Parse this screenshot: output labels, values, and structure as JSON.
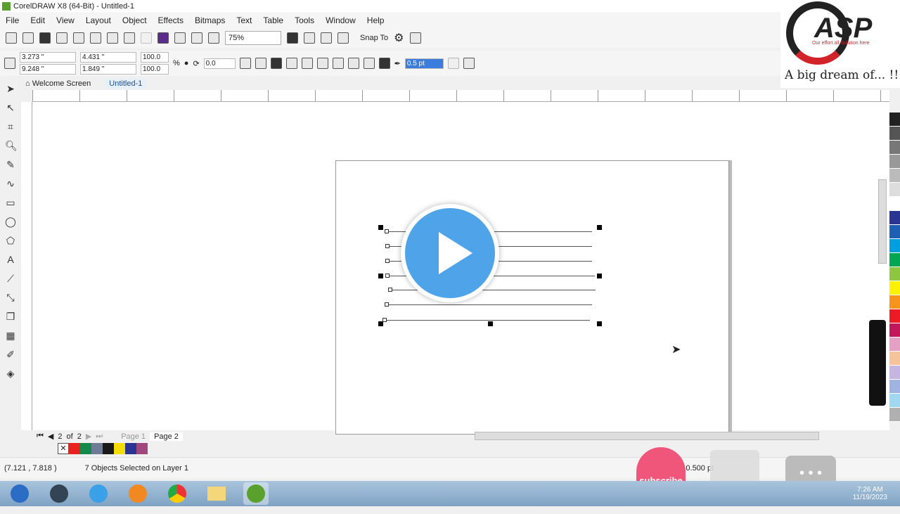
{
  "title": "CorelDRAW X8 (64-Bit) - Untitled-1",
  "menu": [
    "File",
    "Edit",
    "View",
    "Layout",
    "Object",
    "Effects",
    "Bitmaps",
    "Text",
    "Table",
    "Tools",
    "Window",
    "Help"
  ],
  "toolbar": {
    "zoom": "75%",
    "snap": "Snap To"
  },
  "props": {
    "x": "3.273 \"",
    "y": "9.248 \"",
    "w": "4.431 \"",
    "h": "1.849 \"",
    "sx": "100.0",
    "sy": "100.0",
    "pct": "%",
    "rot": "0.0",
    "outline": "0.5 pt"
  },
  "tabs": [
    "Welcome Screen",
    "Untitled-1"
  ],
  "pagenav": {
    "counter": "2",
    "of": "of",
    "total": "2",
    "pages": [
      "Page 1",
      "Page 2"
    ]
  },
  "doc_palette": [
    "#e8231f",
    "#13894a",
    "#6f7c95",
    "#1a1a1a",
    "#f7dc00",
    "#2a3593",
    "#a0487e"
  ],
  "palette": [
    "#222222",
    "#555555",
    "#777777",
    "#999999",
    "#bbbbbb",
    "#dddddd",
    "#ffffff",
    "#2a3593",
    "#1e5fb4",
    "#00a0e0",
    "#00a651",
    "#8dc63f",
    "#fff200",
    "#f7941d",
    "#ed1c24",
    "#c2185b",
    "#e6a0c4",
    "#f5c49a",
    "#c5b5e0",
    "#9fb4e0",
    "#a0d8ef",
    "#b0b0b0"
  ],
  "status": {
    "coords": "(7.121 , 7.818 )",
    "message": "7 Objects Selected on Layer 1",
    "outline": "100  0.500 pt"
  },
  "overlay": {
    "logo_text": "ASP",
    "logo_tagline": "Our effort all Solution here",
    "slogan": "A big dream of... !!",
    "subscribe": "subscribe"
  },
  "clock": {
    "time": "7:26 AM",
    "date": "11/19/2023"
  }
}
